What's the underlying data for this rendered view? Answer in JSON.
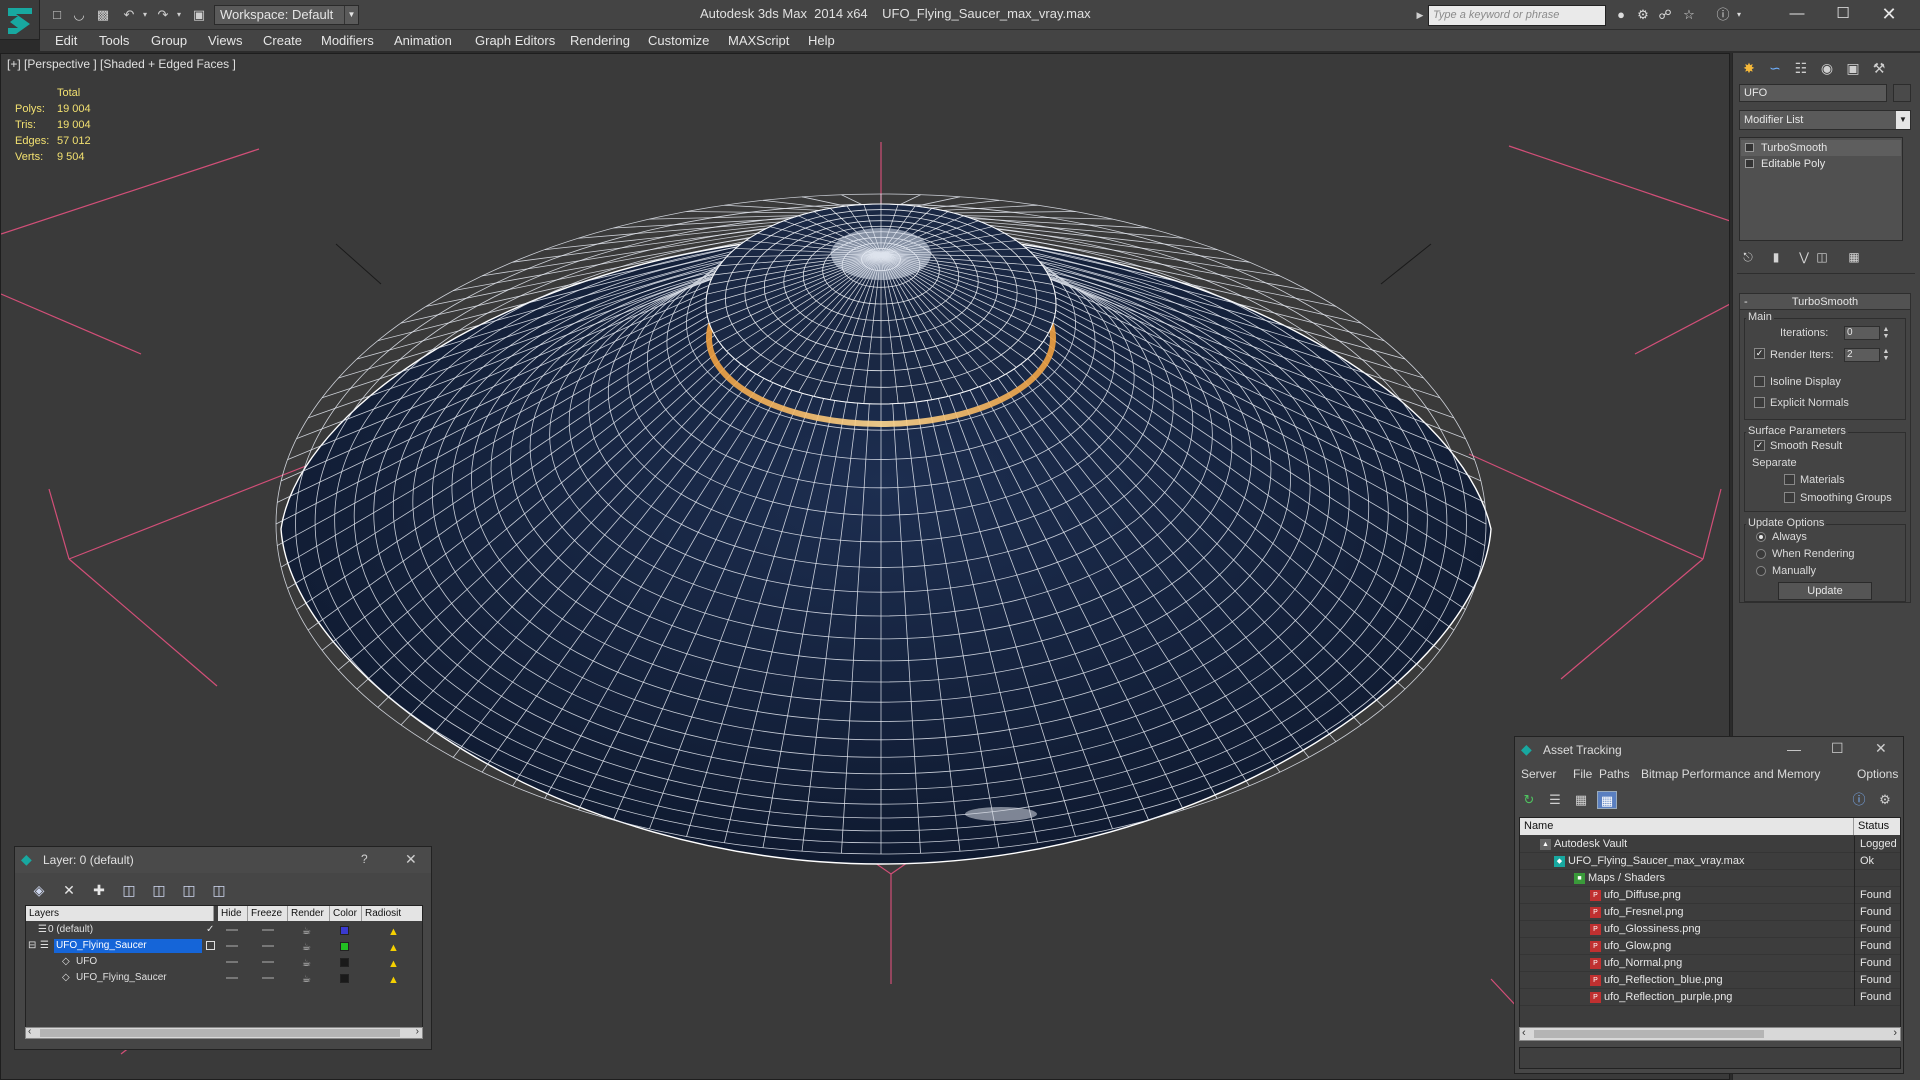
{
  "titlebar": {
    "app": "Autodesk 3ds Max  2014 x64",
    "file": "UFO_Flying_Saucer_max_vray.max",
    "workspace": "Workspace: Default",
    "search_placeholder": "Type a keyword or phrase"
  },
  "menu": [
    "Edit",
    "Tools",
    "Group",
    "Views",
    "Create",
    "Modifiers",
    "Animation",
    "Graph Editors",
    "Rendering",
    "Customize",
    "MAXScript",
    "Help"
  ],
  "viewport": {
    "label": "[+] [Perspective ] [Shaded + Edged Faces ]",
    "stats": {
      "header": "Total",
      "rows": [
        {
          "label": "Polys:",
          "value": "19 004"
        },
        {
          "label": "Tris:",
          "value": "19 004"
        },
        {
          "label": "Edges:",
          "value": "57 012"
        },
        {
          "label": "Verts:",
          "value": "9 504"
        }
      ]
    }
  },
  "command_panel": {
    "object_name": "UFO",
    "modifier_list": "Modifier List",
    "stack": [
      "TurboSmooth",
      "Editable Poly"
    ],
    "turbosmooth": {
      "title": "TurboSmooth",
      "main": "Main",
      "iterations_label": "Iterations:",
      "iterations": "0",
      "render_iters_label": "Render Iters:",
      "render_iters": "2",
      "isoline": "Isoline Display",
      "explicit_normals": "Explicit Normals",
      "surface_params": "Surface Parameters",
      "smooth_result": "Smooth Result",
      "separate": "Separate",
      "materials": "Materials",
      "smoothing_groups": "Smoothing Groups",
      "update_options": "Update Options",
      "always": "Always",
      "when_rendering": "When Rendering",
      "manually": "Manually",
      "update": "Update"
    }
  },
  "layer_panel": {
    "title": "Layer: 0 (default)",
    "help": "?",
    "columns": [
      "Layers",
      "Hide",
      "Freeze",
      "Render",
      "Color",
      "Radiosit"
    ],
    "rows": [
      {
        "name": "0 (default)",
        "color": "#3a3ad0"
      },
      {
        "name": "UFO_Flying_Saucer",
        "color": "#22c022"
      },
      {
        "name": "UFO",
        "color": "#1a1a1a"
      },
      {
        "name": "UFO_Flying_Saucer",
        "color": "#1a1a1a"
      }
    ]
  },
  "asset_tracking": {
    "title": "Asset Tracking",
    "menu": [
      "Server",
      "File",
      "Paths",
      "Bitmap Performance and Memory",
      "Options"
    ],
    "columns": [
      "Name",
      "Status"
    ],
    "rows": [
      {
        "name": "Autodesk Vault",
        "status": "Logged"
      },
      {
        "name": "UFO_Flying_Saucer_max_vray.max",
        "status": "Ok"
      },
      {
        "name": "Maps / Shaders",
        "status": ""
      },
      {
        "name": "ufo_Diffuse.png",
        "status": "Found"
      },
      {
        "name": "ufo_Fresnel.png",
        "status": "Found"
      },
      {
        "name": "ufo_Glossiness.png",
        "status": "Found"
      },
      {
        "name": "ufo_Glow.png",
        "status": "Found"
      },
      {
        "name": "ufo_Normal.png",
        "status": "Found"
      },
      {
        "name": "ufo_Reflection_blue.png",
        "status": "Found"
      },
      {
        "name": "ufo_Reflection_purple.png",
        "status": "Found"
      }
    ]
  },
  "colors": {
    "accent_selected": "#1565d8",
    "stats_text": "#f2e070",
    "mesh_wire": "#ffffff",
    "mesh_fill": "#16243f",
    "grid_axis": "#e0507a",
    "glow_ring": "#f0a040"
  }
}
